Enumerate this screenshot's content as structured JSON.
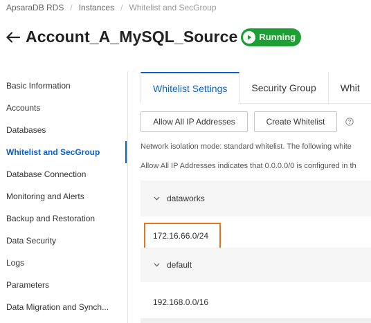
{
  "breadcrumb": {
    "items": [
      "ApsaraDB RDS",
      "Instances",
      "Whitelist and SecGroup"
    ]
  },
  "header": {
    "title": "Account_A_MySQL_Source",
    "status": "Running",
    "status_color": "#1e9e34"
  },
  "sidebar": {
    "items": [
      {
        "label": "Basic Information"
      },
      {
        "label": "Accounts"
      },
      {
        "label": "Databases"
      },
      {
        "label": "Whitelist and SecGroup",
        "active": true
      },
      {
        "label": "Database Connection"
      },
      {
        "label": "Monitoring and Alerts"
      },
      {
        "label": "Backup and Restoration"
      },
      {
        "label": "Data Security"
      },
      {
        "label": "Logs"
      },
      {
        "label": "Parameters"
      },
      {
        "label": "Data Migration and Synch..."
      }
    ]
  },
  "tabs": [
    {
      "label": "Whitelist Settings",
      "active": true
    },
    {
      "label": "Security Group"
    },
    {
      "label": "Whit"
    }
  ],
  "toolbar": {
    "allow_all_label": "Allow All IP Addresses",
    "create_label": "Create Whitelist"
  },
  "description": {
    "line1": "Network isolation mode: standard whitelist. The following white",
    "line2": "Allow All IP Addresses indicates that 0.0.0.0/0 is configured in th"
  },
  "whitelists": [
    {
      "name": "dataworks",
      "ip": "172.16.66.0/24",
      "highlighted": true
    },
    {
      "name": "default",
      "ip": "192.168.0.0/16"
    }
  ],
  "colors": {
    "accent": "#0a5fc9",
    "highlight": "#e8721f"
  }
}
